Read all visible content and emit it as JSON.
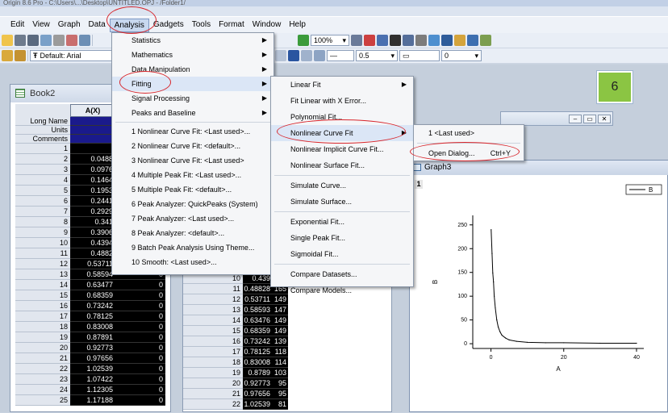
{
  "window": {
    "title": "Origin 8.6 Pro - C:\\Users\\...\\Desktop\\UNTITLED.OPJ - /Folder1/"
  },
  "menubar": [
    "Edit",
    "View",
    "Graph",
    "Data",
    "Analysis",
    "Gadgets",
    "Tools",
    "Format",
    "Window",
    "Help"
  ],
  "toolbar": {
    "zoom": "100%",
    "font": "Default: Arial",
    "line_width": "0.5",
    "angle": "0"
  },
  "badge": "6",
  "book2": {
    "title": "Book2",
    "col_a": "A(X)",
    "header_rows": [
      "Long Name",
      "Units",
      "Comments"
    ],
    "rows": [
      {
        "n": "1",
        "a": "",
        "b": ""
      },
      {
        "n": "2",
        "a": "0.0488",
        "b": ""
      },
      {
        "n": "3",
        "a": "0.0976",
        "b": ""
      },
      {
        "n": "4",
        "a": "0.1464",
        "b": ""
      },
      {
        "n": "5",
        "a": "0.1953",
        "b": ""
      },
      {
        "n": "6",
        "a": "0.2441",
        "b": ""
      },
      {
        "n": "7",
        "a": "0.2929",
        "b": ""
      },
      {
        "n": "8",
        "a": "0.341",
        "b": ""
      },
      {
        "n": "9",
        "a": "0.3906",
        "b": ""
      },
      {
        "n": "10",
        "a": "0.4394",
        "b": ""
      },
      {
        "n": "11",
        "a": "0.4882",
        "b": ""
      },
      {
        "n": "12",
        "a": "0.53711",
        "b": "0"
      },
      {
        "n": "13",
        "a": "0.58594",
        "b": "0"
      },
      {
        "n": "14",
        "a": "0.63477",
        "b": "0"
      },
      {
        "n": "15",
        "a": "0.68359",
        "b": "0"
      },
      {
        "n": "16",
        "a": "0.73242",
        "b": "0"
      },
      {
        "n": "17",
        "a": "0.78125",
        "b": "0"
      },
      {
        "n": "18",
        "a": "0.83008",
        "b": "0"
      },
      {
        "n": "19",
        "a": "0.87891",
        "b": "0"
      },
      {
        "n": "20",
        "a": "0.92773",
        "b": "0"
      },
      {
        "n": "21",
        "a": "0.97656",
        "b": "0"
      },
      {
        "n": "22",
        "a": "1.02539",
        "b": "0"
      },
      {
        "n": "23",
        "a": "1.07422",
        "b": "0"
      },
      {
        "n": "24",
        "a": "1.12305",
        "b": "0"
      },
      {
        "n": "25",
        "a": "1.17188",
        "b": "0"
      }
    ]
  },
  "sheet2": {
    "rows": [
      {
        "n": "10",
        "a": "0.439",
        "b": ""
      },
      {
        "n": "11",
        "a": "0.48828",
        "b": "165"
      },
      {
        "n": "12",
        "a": "0.53711",
        "b": "149"
      },
      {
        "n": "13",
        "a": "0.58593",
        "b": "147"
      },
      {
        "n": "14",
        "a": "0.63476",
        "b": "149"
      },
      {
        "n": "15",
        "a": "0.68359",
        "b": "149"
      },
      {
        "n": "16",
        "a": "0.73242",
        "b": "139"
      },
      {
        "n": "17",
        "a": "0.78125",
        "b": "118"
      },
      {
        "n": "18",
        "a": "0.83008",
        "b": "114"
      },
      {
        "n": "19",
        "a": "0.8789",
        "b": "103"
      },
      {
        "n": "20",
        "a": "0.92773",
        "b": "95"
      },
      {
        "n": "21",
        "a": "0.97656",
        "b": "95"
      },
      {
        "n": "22",
        "a": "1.02539",
        "b": "81"
      }
    ]
  },
  "analysis_menu": [
    {
      "label": "Statistics",
      "sub": true
    },
    {
      "label": "Mathematics",
      "sub": true
    },
    {
      "label": "Data Manipulation",
      "sub": true
    },
    {
      "label": "Fitting",
      "sub": true,
      "hl": true
    },
    {
      "label": "Signal Processing",
      "sub": true
    },
    {
      "label": "Peaks and Baseline",
      "sub": true
    },
    {
      "label": "1 Nonlinear Curve Fit: <Last used>..."
    },
    {
      "label": "2 Nonlinear Curve Fit: <default>..."
    },
    {
      "label": "3 Nonlinear Curve Fit: <Last used>"
    },
    {
      "label": "4 Multiple Peak Fit: <Last used>..."
    },
    {
      "label": "5 Multiple Peak Fit: <default>..."
    },
    {
      "label": "6 Peak Analyzer: QuickPeaks (System)"
    },
    {
      "label": "7 Peak Analyzer: <Last used>..."
    },
    {
      "label": "8 Peak Analyzer: <default>..."
    },
    {
      "label": "9 Batch Peak Analysis Using Theme..."
    },
    {
      "label": "10 Smooth: <Last used>..."
    }
  ],
  "fitting_menu": [
    {
      "label": "Linear Fit",
      "sub": true
    },
    {
      "label": "Fit Linear with X Error..."
    },
    {
      "label": "Polynomial Fit..."
    },
    {
      "label": "Nonlinear Curve Fit",
      "sub": true,
      "hl": true
    },
    {
      "label": "Nonlinear Implicit Curve Fit..."
    },
    {
      "label": "Nonlinear Surface Fit..."
    },
    {
      "label": "Simulate Curve..."
    },
    {
      "label": "Simulate Surface..."
    },
    {
      "label": "Exponential Fit..."
    },
    {
      "label": "Single Peak Fit..."
    },
    {
      "label": "Sigmoidal Fit..."
    },
    {
      "label": "Compare Datasets..."
    },
    {
      "label": "Compare Models..."
    }
  ],
  "nlfit_menu": [
    {
      "label": "1 <Last used>",
      "shortcut": ""
    },
    {
      "label": "Open Dialog...",
      "shortcut": "Ctrl+Y"
    }
  ],
  "graph3": {
    "title": "Graph3",
    "layer": "1"
  },
  "chart_data": {
    "type": "line",
    "xlabel": "A",
    "ylabel": "B",
    "legend": "B",
    "legend_position": "top-right",
    "xlim": [
      -5,
      42
    ],
    "ylim": [
      -10,
      270
    ],
    "xticks": [
      0,
      20,
      40
    ],
    "yticks": [
      0,
      50,
      100,
      150,
      200,
      250
    ],
    "series": [
      {
        "name": "B",
        "x": [
          0.05,
          0.3,
          0.5,
          0.7,
          0.9,
          1.2,
          1.6,
          2,
          2.5,
          3,
          4,
          5,
          7,
          10,
          15,
          20,
          30,
          40
        ],
        "y": [
          240,
          190,
          149,
          130,
          100,
          75,
          50,
          35,
          25,
          18,
          12,
          8,
          5,
          3,
          2,
          2,
          1,
          1
        ]
      }
    ]
  }
}
